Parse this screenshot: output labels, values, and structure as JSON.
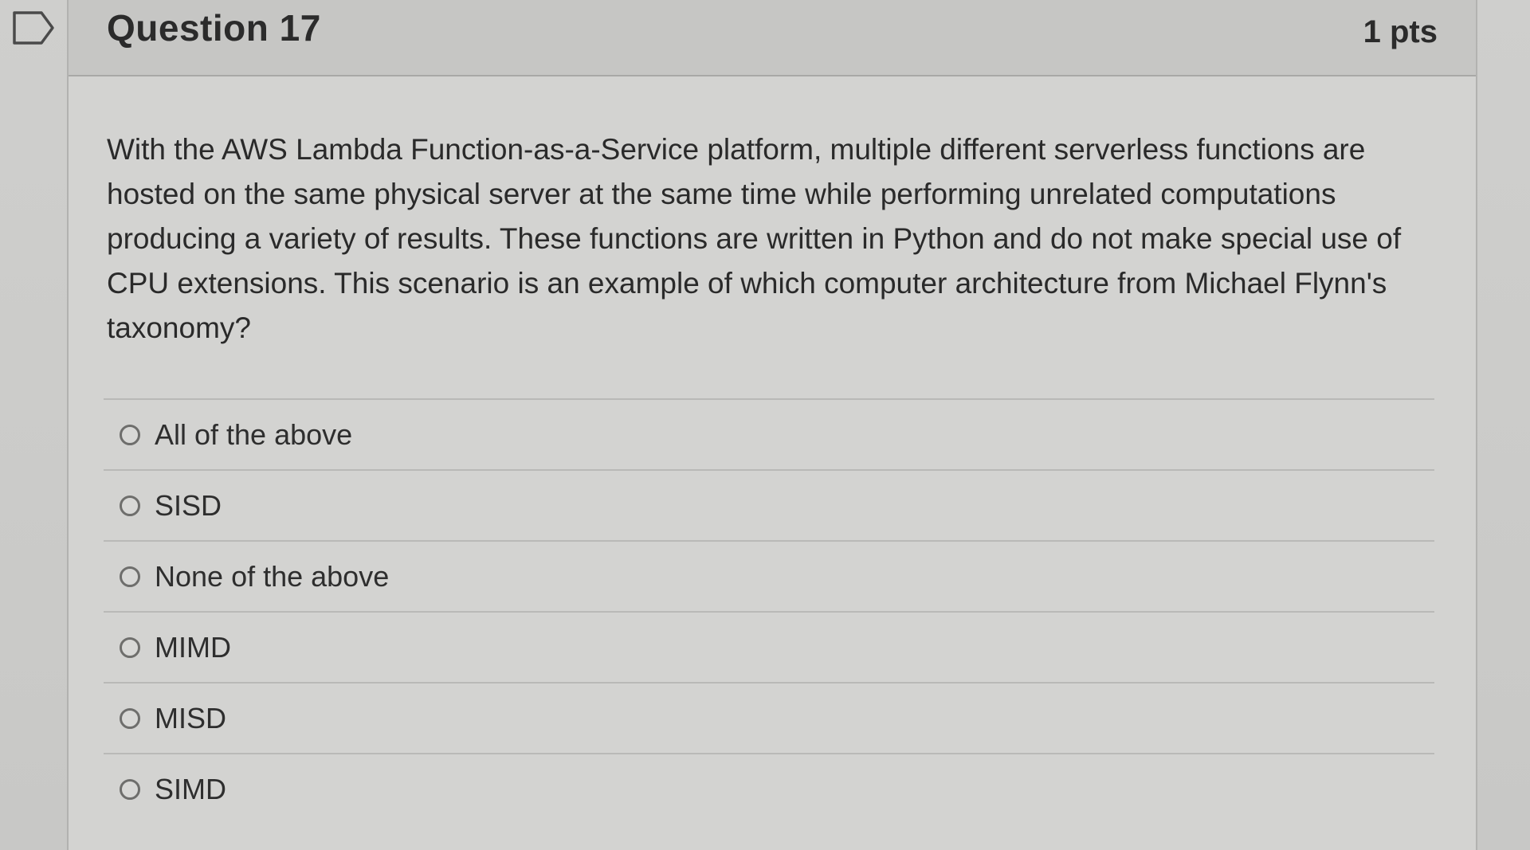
{
  "question": {
    "title": "Question 17",
    "points": "1 pts",
    "text": "With the AWS Lambda Function-as-a-Service platform, multiple different serverless functions are hosted on the same physical server at the same time while performing unrelated computations producing a variety of results.  These functions are written in Python and do not make special use of CPU extensions. This scenario is an example of which computer architecture from Michael Flynn's taxonomy?",
    "flag_icon": "flag-question-icon"
  },
  "answers": [
    {
      "label": "All of the above",
      "selected": false
    },
    {
      "label": "SISD",
      "selected": false
    },
    {
      "label": "None of the above",
      "selected": false
    },
    {
      "label": "MIMD",
      "selected": false
    },
    {
      "label": "MISD",
      "selected": false
    },
    {
      "label": "SIMD",
      "selected": false
    }
  ]
}
